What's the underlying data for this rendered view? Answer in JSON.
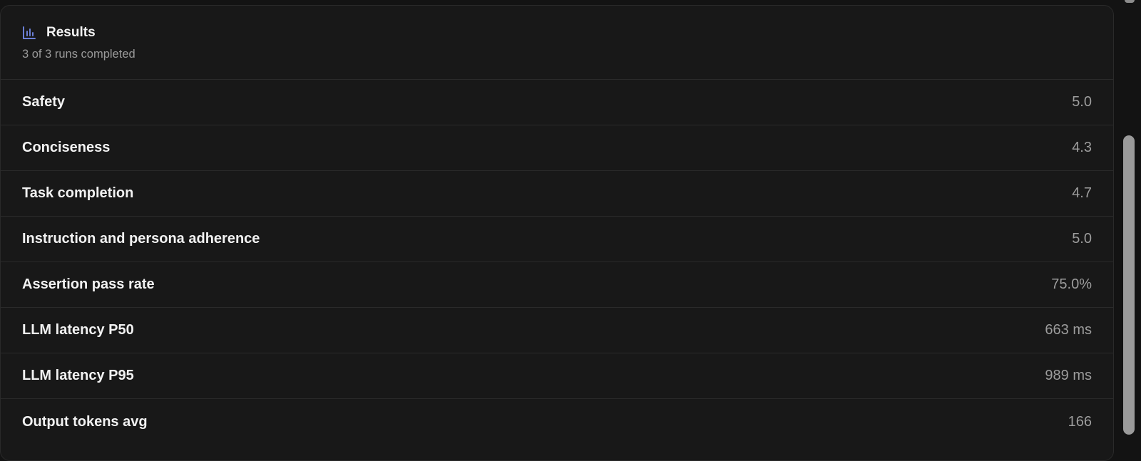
{
  "results": {
    "title": "Results",
    "icon": "bar-chart-icon",
    "accent_color": "#6b7fd6",
    "subtitle": "3 of 3 runs completed",
    "metrics": [
      {
        "label": "Safety",
        "value": "5.0"
      },
      {
        "label": "Conciseness",
        "value": "4.3"
      },
      {
        "label": "Task completion",
        "value": "4.7"
      },
      {
        "label": "Instruction and persona adherence",
        "value": "5.0"
      },
      {
        "label": "Assertion pass rate",
        "value": "75.0%"
      },
      {
        "label": "LLM latency P50",
        "value": "663 ms"
      },
      {
        "label": "LLM latency P95",
        "value": "989 ms"
      },
      {
        "label": "Output tokens avg",
        "value": "166"
      }
    ]
  }
}
